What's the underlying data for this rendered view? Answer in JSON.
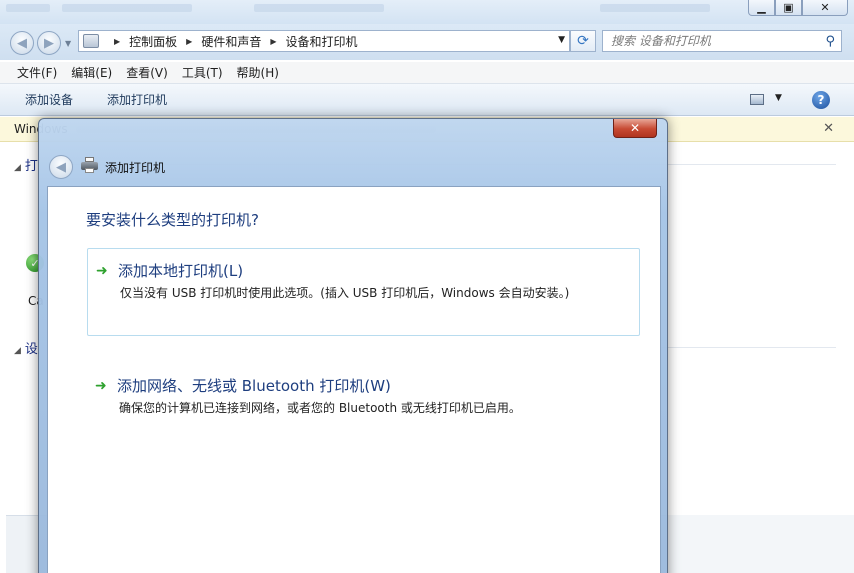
{
  "explorer": {
    "address": {
      "crumbs": [
        "控制面板",
        "硬件和声音",
        "设备和打印机"
      ]
    },
    "search": {
      "placeholder": "搜索 设备和打印机"
    },
    "menu": [
      "文件(F)",
      "编辑(E)",
      "查看(V)",
      "工具(T)",
      "帮助(H)"
    ],
    "commands": [
      "添加设备",
      "添加打印机"
    ],
    "infobar": {
      "text": "Windows"
    },
    "groups": [
      "打",
      "设"
    ],
    "device_label": "Ca"
  },
  "dialog": {
    "title": "添加打印机",
    "question": "要安装什么类型的打印机?",
    "options": [
      {
        "title": "添加本地打印机(L)",
        "description": "仅当没有 USB 打印机时使用此选项。(插入 USB 打印机后，Windows 会自动安装。)"
      },
      {
        "title": "添加网络、无线或 Bluetooth 打印机(W)",
        "description": "确保您的计算机已连接到网络，或者您的 Bluetooth 或无线打印机已启用。"
      }
    ]
  },
  "colors": {
    "link_blue": "#1e3e7f",
    "arrow_green": "#2ea12e",
    "close_red": "#c74a33",
    "infobar_bg": "#fcf8dc"
  },
  "icons": [
    "back-icon",
    "forward-icon",
    "printer-icon",
    "refresh-icon",
    "search-icon",
    "help-icon",
    "close-icon",
    "green-arrow-icon",
    "check-icon"
  ]
}
